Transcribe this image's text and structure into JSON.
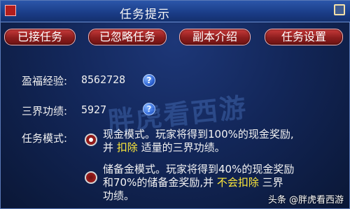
{
  "window": {
    "title": "任务提示"
  },
  "tabs": [
    {
      "label": "已接任务"
    },
    {
      "label": "已忽略任务"
    },
    {
      "label": "副本介绍"
    },
    {
      "label": "任务设置"
    }
  ],
  "info": {
    "exp_label": "盈福经验:",
    "exp_value": "8562728",
    "merit_label": "三界功绩:",
    "merit_value": "5927",
    "help_glyph": "?"
  },
  "mode": {
    "label": "任务模式:",
    "options": [
      {
        "selected": true,
        "line1": "现金模式。玩家将得到100%的现金奖励,",
        "line2_a": "并 ",
        "line2_hl": "扣除",
        "line2_b": " 适量的三界功绩。"
      },
      {
        "selected": false,
        "line1": "储备金模式。玩家将得到40%的现金奖励",
        "line2_a": "和70%的储备金奖励,并 ",
        "line2_hl": "不会扣除",
        "line2_b": " 三界",
        "line3": "功绩。"
      }
    ]
  },
  "overlay": {
    "watermark": "胖虎看西游",
    "source": "头条 @胖虎看西游"
  },
  "colors": {
    "highlight": "#ffea3a",
    "button_red": "#8c1d1d",
    "panel_blue": "#13275a"
  }
}
